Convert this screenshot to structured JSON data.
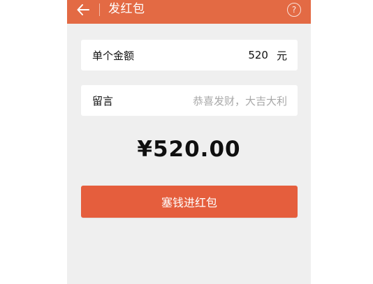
{
  "header": {
    "back_icon": "arrow-left-icon",
    "title": "发红包",
    "help_glyph": "?"
  },
  "form": {
    "amount": {
      "label": "单个金额",
      "value": "520",
      "unit": "元"
    },
    "message": {
      "label": "留言",
      "placeholder": "恭喜发财，大吉大利"
    }
  },
  "total": "¥520.00",
  "submit_label": "塞钱进红包",
  "colors": {
    "header_bg": "#e36a44",
    "button_bg": "#e55e3d",
    "page_bg": "#efefef"
  }
}
